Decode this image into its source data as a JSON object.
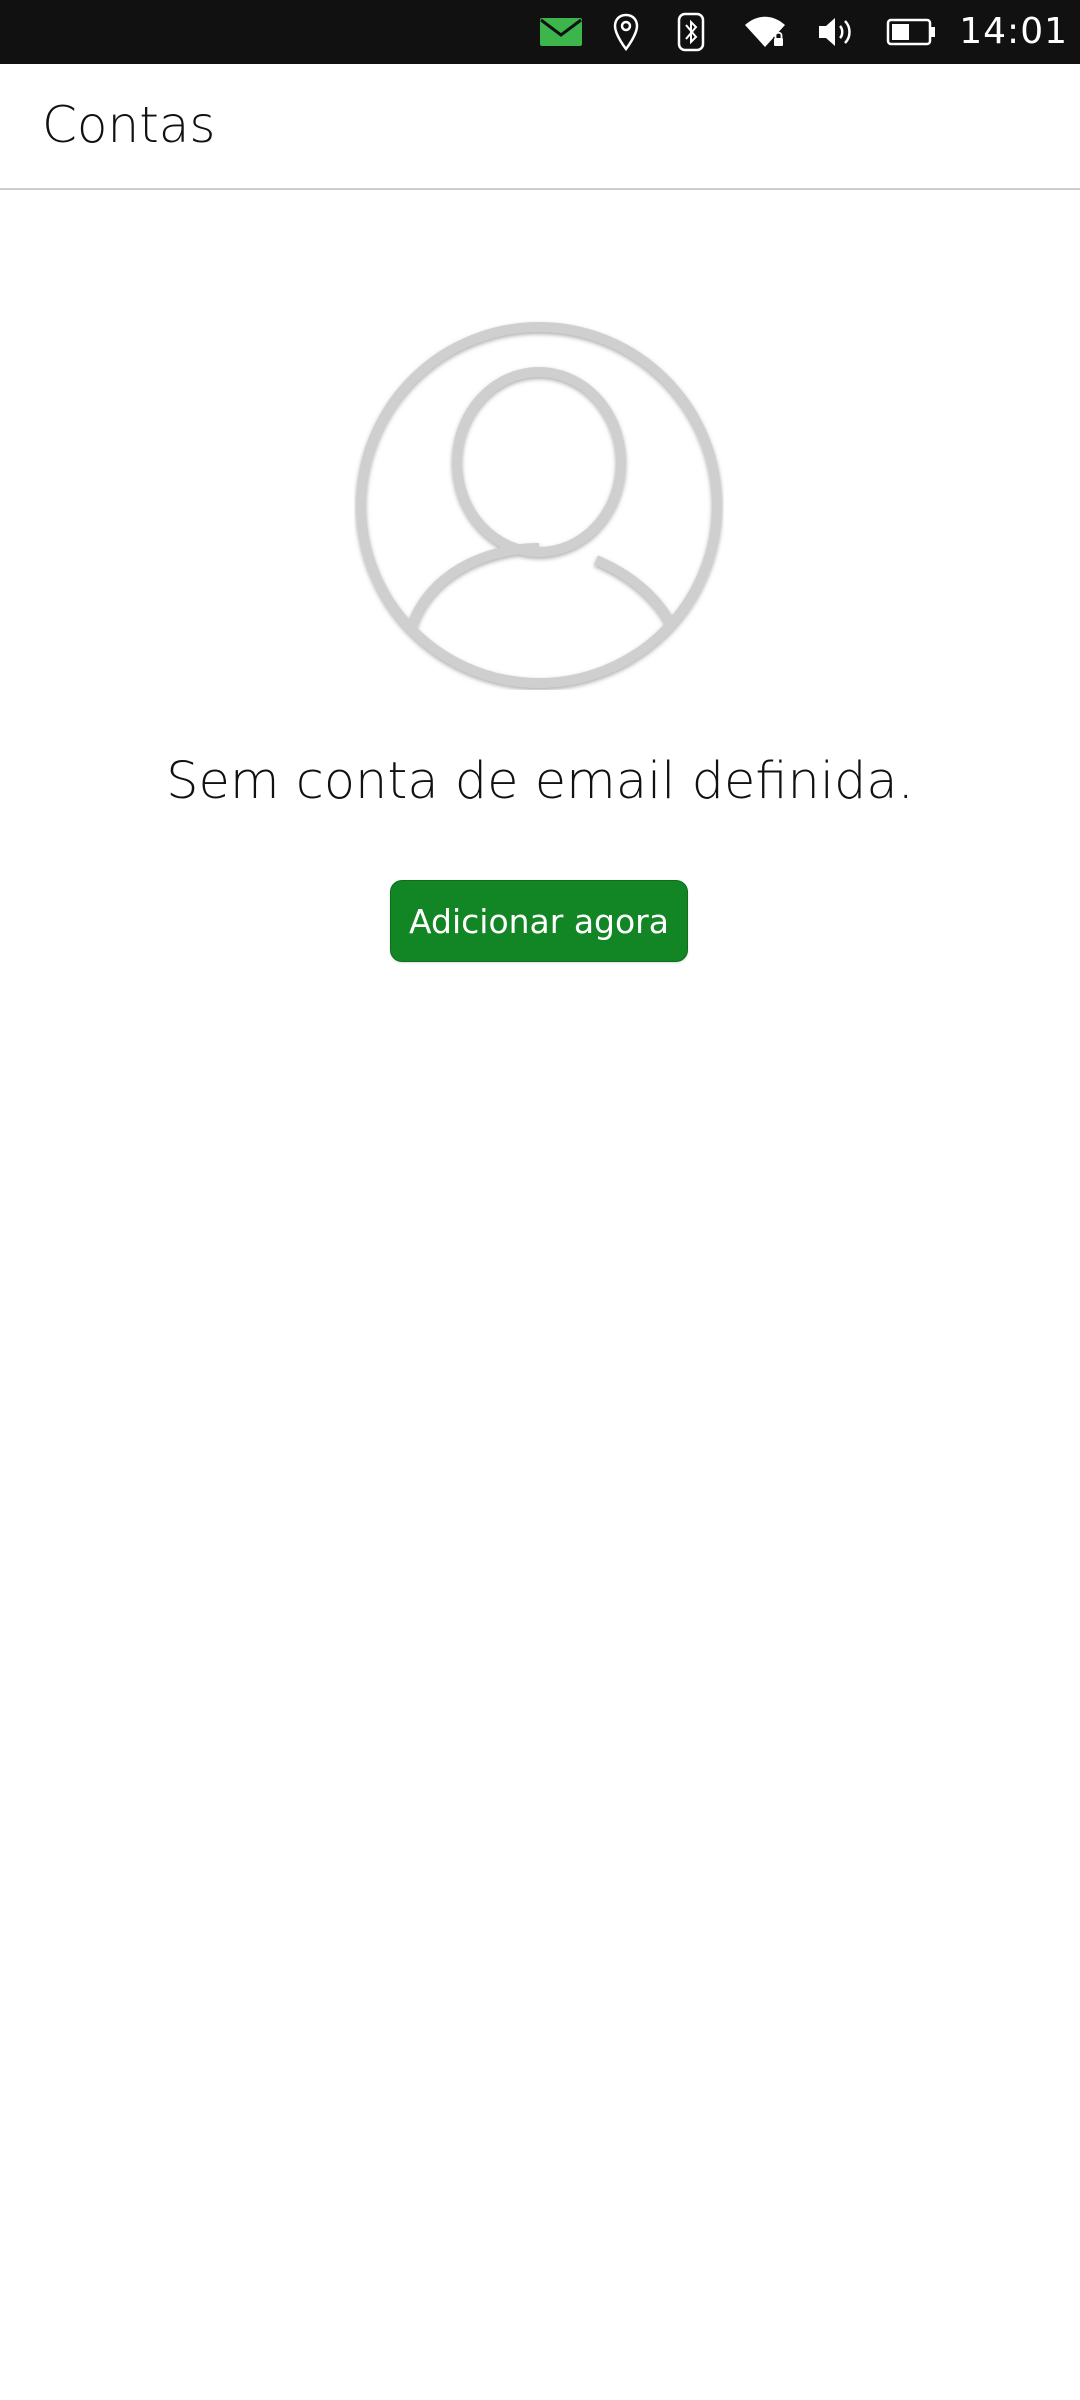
{
  "status_bar": {
    "time": "14:01",
    "icons": [
      "mail-icon",
      "location-icon",
      "bluetooth-icon",
      "wifi-icon",
      "volume-icon",
      "battery-icon"
    ],
    "background_color": "#111111",
    "mail_icon_color": "#3cb64a"
  },
  "header": {
    "title": "Contas"
  },
  "main": {
    "avatar_icon": "user-placeholder-icon",
    "empty_message": "Sem conta de email definida.",
    "add_button_label": "Adicionar agora",
    "accent_color": "#128525"
  }
}
